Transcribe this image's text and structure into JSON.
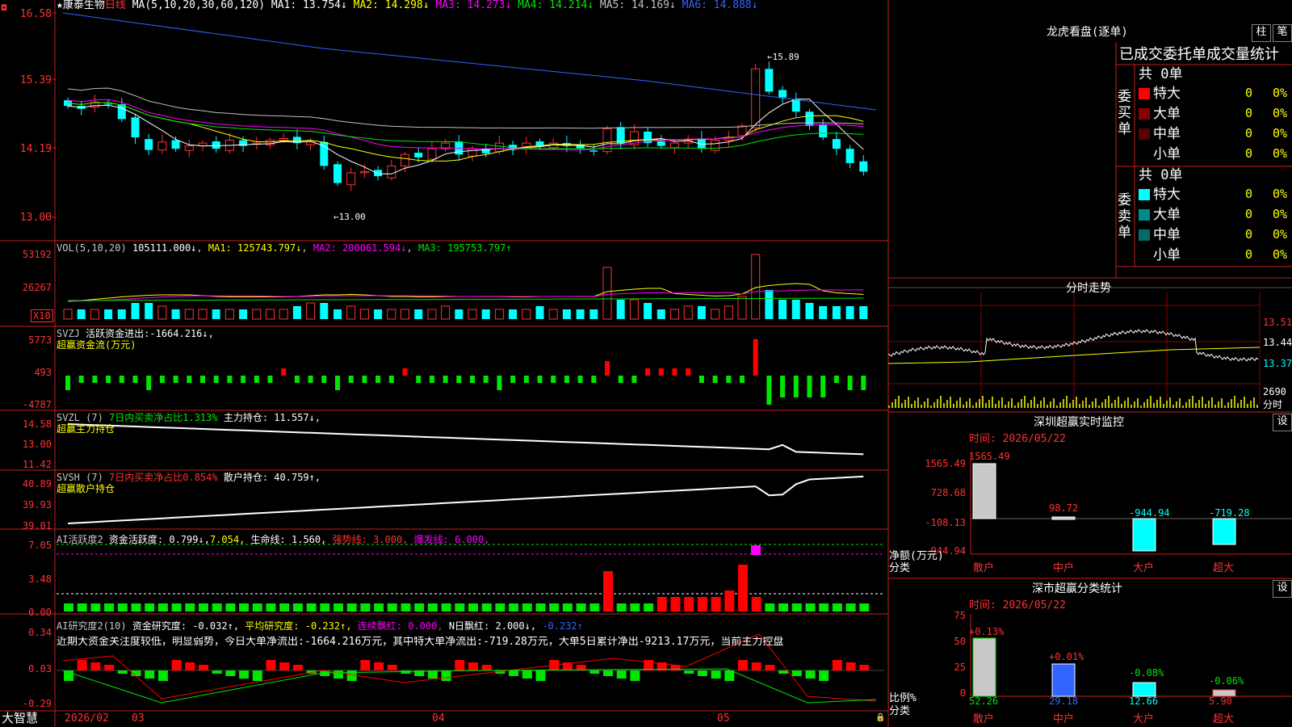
{
  "header": {
    "star": "★",
    "name": "康泰生物",
    "period": "日线",
    "ma_label": "MA(5,10,20,30,60,120)",
    "ma": [
      {
        "k": "MA1",
        "v": "13.754↓",
        "c": "#ffffff"
      },
      {
        "k": "MA2",
        "v": "14.298↓",
        "c": "#ffff00"
      },
      {
        "k": "MA3",
        "v": "14.273↓",
        "c": "#ff00ff"
      },
      {
        "k": "MA4",
        "v": "14.214↓",
        "c": "#00e600"
      },
      {
        "k": "MA5",
        "v": "14.169↓",
        "c": "#c0c0c0"
      },
      {
        "k": "MA6",
        "v": "14.888↓",
        "c": "#3264ff"
      }
    ]
  },
  "price_axis": [
    "16.58",
    "15.39",
    "14.19",
    "13.00"
  ],
  "price_annot": {
    "high": "15.89",
    "low": "13.00"
  },
  "vol": {
    "label": "VOL(5,10,20)",
    "val": "105111.000↓",
    "ma1": "MA1: 125743.797↓",
    "ma2": "MA2: 200061.594↓",
    "ma3": "MA3: 195753.797↑",
    "axis": [
      "53192",
      "26267"
    ],
    "unit": "X10"
  },
  "svzj": {
    "label": "SVZJ",
    "title": "活跃资金进出:",
    "val": "-1664.216↓,",
    "sub": "超赢资金流(万元)",
    "axis": [
      "5773",
      "493",
      "-4787"
    ]
  },
  "svzl": {
    "label": "SVZL (7)",
    "t1": "7日内买卖净占比1.313%",
    "t2": "主力持仓: 11.557↓,",
    "sub": "超赢主力持仓",
    "axis": [
      "14.58",
      "13.00",
      "11.42"
    ]
  },
  "svsh": {
    "label": "SVSH (7)",
    "t1": "7日内买卖净占比0.854%",
    "t2": "散户持仓: 40.759↑,",
    "sub": "超赢散户持仓",
    "axis": [
      "40.89",
      "39.93",
      "39.01"
    ]
  },
  "ai1": {
    "label": "AI活跃度2",
    "t1": "资金活跃度: 0.799↓,",
    "t2": "7.054,",
    "t3": "生命线: 1.560,",
    "t4": "强势线: 3.000,",
    "t5": "爆发线: 6.000,",
    "axis": [
      "7.05",
      "3.48",
      "0.00"
    ]
  },
  "ai2": {
    "label": "AI研究度2(10)",
    "t1": "资金研究度: -0.032↑,",
    "t2": "平均研究度: -0.232↑,",
    "t3": "连续飘红: 0.000,",
    "t4": "N日飘红: 2.000↓,",
    "t5": "-0.232↑",
    "comment": "近期大资金关注度较低，明显弱势，今日大单净流出:-1664.216万元，其中特大单净流出:-719.28万元，大单5日累计净出-9213.17万元，当前主力控盘",
    "axis": [
      "0.34",
      "0.03",
      "-0.29"
    ]
  },
  "timeline": {
    "brand": "大智慧",
    "d1": "2026/02",
    "m1": "03",
    "m2": "04",
    "m3": "05"
  },
  "right": {
    "title": "龙虎看盘(逐单)",
    "btn1": "柱",
    "btn2": "笔",
    "sub": "已成交委托单成交量统计",
    "buy_label": "委买单",
    "sell_label": "委卖单",
    "buy_total": "共 0单",
    "sell_total": "共 0单",
    "buy_rows": [
      {
        "n": "特大",
        "c": "#ff0000",
        "v": "0",
        "p": "0%"
      },
      {
        "n": "大单",
        "c": "#8b0000",
        "v": "0",
        "p": "0%"
      },
      {
        "n": "中单",
        "c": "#5a0000",
        "v": "0",
        "p": "0%"
      },
      {
        "n": "小单",
        "c": "",
        "v": "0",
        "p": "0%"
      }
    ],
    "sell_rows": [
      {
        "n": "特大",
        "c": "#00ffff",
        "v": "0",
        "p": "0%"
      },
      {
        "n": "大单",
        "c": "#008b8b",
        "v": "0",
        "p": "0%"
      },
      {
        "n": "中单",
        "c": "#006b6b",
        "v": "0",
        "p": "0%"
      },
      {
        "n": "小单",
        "c": "",
        "v": "0",
        "p": "0%"
      }
    ],
    "intraday_title": "分时走势",
    "intraday_axis": [
      "13.51",
      "13.44",
      "13.37",
      "2690",
      "分时"
    ],
    "monitor_title": "深圳超赢实时监控",
    "monitor_btn": "设",
    "monitor_time": "时间: 2026/05/22",
    "monitor_axis": [
      "1565.49",
      "728.68",
      "-108.13",
      "-944.94"
    ],
    "monitor_ylabel": "净额(万元)",
    "monitor_xlabel": "分类",
    "monitor_bars": [
      {
        "n": "散户",
        "v": "1565.49"
      },
      {
        "n": "中户",
        "v": "98.72"
      },
      {
        "n": "大户",
        "v": "-944.94"
      },
      {
        "n": "超大",
        "v": "-719.28"
      }
    ],
    "class_title": "深市超赢分类统计",
    "class_btn": "设",
    "class_time": "时间: 2026/05/22",
    "class_axis": [
      "75",
      "50",
      "25",
      "0"
    ],
    "class_ylabel": "比例%",
    "class_xlabel": "分类",
    "class_bars": [
      {
        "n": "散户",
        "v": "52.26",
        "d": "+0.13%"
      },
      {
        "n": "中户",
        "v": "29.18",
        "d": "+0.01%"
      },
      {
        "n": "大户",
        "v": "12.66",
        "d": "-0.08%"
      },
      {
        "n": "超大",
        "v": "5.90",
        "d": "-0.06%"
      }
    ]
  }
}
